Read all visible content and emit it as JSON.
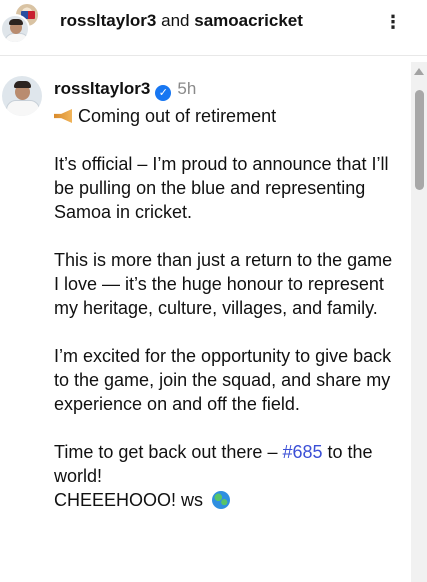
{
  "header": {
    "user1": "rossltaylor3",
    "conjunction": "and",
    "user2": "samoacricket",
    "more_icon": "⋮"
  },
  "post": {
    "username": "rossltaylor3",
    "verified_icon": "✓",
    "time": "5h",
    "headline": "Coming out of retirement",
    "paragraphs": [
      "It’s official – I’m proud to announce that I’ll be pulling on the blue and representing Samoa in cricket.",
      "This is more than just a return to the game I love — it’s the huge honour to represent my heritage, culture, villages, and family.",
      "I’m excited for the opportunity to give back to the game, join the squad, and share my experience on and off the field."
    ],
    "closing_text": "Time to get back out there – ",
    "hashtag": "#685",
    "closing_suffix": " to the world!",
    "signoff": "CHEEEHOOO! ws"
  },
  "icons": {
    "horn": "megaphone-icon",
    "globe": "globe-icon",
    "verified": "verified-badge-icon",
    "more": "more-options-icon"
  },
  "colors": {
    "verified": "#1877f2",
    "hashtag": "#3b4fd6",
    "timestamp": "#8a8a8a"
  }
}
